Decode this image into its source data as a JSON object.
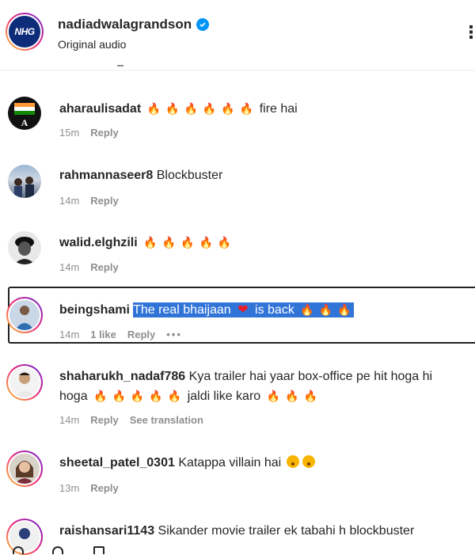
{
  "header": {
    "avatar_text": "NHG",
    "username": "nadiadwalagrandson",
    "subtitle": "Original audio"
  },
  "comments": [
    {
      "user": "aharaulisadat",
      "text": "fire hai",
      "time": "15m",
      "reply": "Reply",
      "fire_count": 6
    },
    {
      "user": "rahmannaseer8",
      "text": "Blockbuster",
      "time": "14m",
      "reply": "Reply"
    },
    {
      "user": "walid.elghzili",
      "text": "",
      "time": "14m",
      "reply": "Reply",
      "fire_count": 5
    },
    {
      "user": "beingshami",
      "text_part1": "The real bhaijaan",
      "text_part2": "is back",
      "time": "14m",
      "likes": "1 like",
      "reply": "Reply",
      "more": "•••"
    },
    {
      "user": "shaharukh_nadaf786",
      "text_part1": "Kya trailer hai yaar box-office pe hit hoga hi hoga",
      "text_part2": "jaldi like karo",
      "time": "14m",
      "reply": "Reply",
      "translate": "See translation"
    },
    {
      "user": "sheetal_patel_0301",
      "text": "Katappa villain hai",
      "time": "13m",
      "reply": "Reply"
    },
    {
      "user": "raishansari1143",
      "text": "Sikander movie trailer ek tabahi h blockbuster"
    }
  ],
  "colors": {
    "accent": "#0095f6",
    "highlight": "#3174d8",
    "muted": "#8e8e8e",
    "text": "#262626"
  }
}
